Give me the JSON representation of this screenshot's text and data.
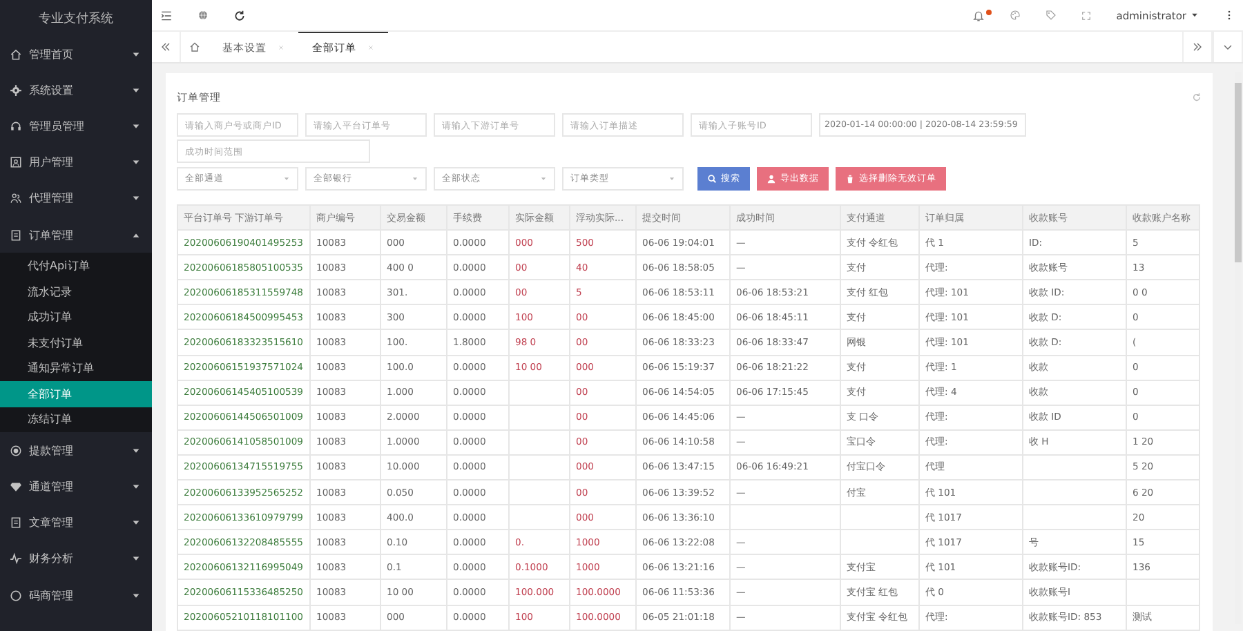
{
  "sidebar": {
    "title": "专业支付系统",
    "items": [
      {
        "label": "管理首页",
        "kind": "home",
        "expanded": false,
        "selected": false
      },
      {
        "label": "系统设置",
        "kind": "gear",
        "expanded": false,
        "selected": false
      },
      {
        "label": "管理员管理",
        "kind": "headset",
        "expanded": false,
        "selected": false
      },
      {
        "label": "用户管理",
        "kind": "user",
        "expanded": false,
        "selected": false
      },
      {
        "label": "代理管理",
        "kind": "people",
        "expanded": false,
        "selected": false
      },
      {
        "label": "订单管理",
        "kind": "doc",
        "expanded": true,
        "selected": false,
        "children": [
          {
            "label": "代付Api订单",
            "selected": false
          },
          {
            "label": "流水记录",
            "selected": false
          },
          {
            "label": "成功订单",
            "selected": false
          },
          {
            "label": "未支付订单",
            "selected": false
          },
          {
            "label": "通知异常订单",
            "selected": false
          },
          {
            "label": "全部订单",
            "selected": true
          },
          {
            "label": "冻结订单",
            "selected": false
          }
        ]
      },
      {
        "label": "提款管理",
        "kind": "target",
        "expanded": false,
        "selected": false
      },
      {
        "label": "通道管理",
        "kind": "diamond",
        "expanded": false,
        "selected": false
      },
      {
        "label": "文章管理",
        "kind": "doc",
        "expanded": false,
        "selected": false
      },
      {
        "label": "财务分析",
        "kind": "chart",
        "expanded": false,
        "selected": false
      },
      {
        "label": "码商管理",
        "kind": "circle",
        "expanded": false,
        "selected": false
      }
    ]
  },
  "topbar": {
    "user": "administrator",
    "notification": true
  },
  "tabs": [
    {
      "label": "基本设置",
      "selected": false
    },
    {
      "label": "全部订单",
      "selected": true
    }
  ],
  "panel": {
    "title": "订单管理",
    "fields": [
      {
        "kind": "input",
        "placeholder": "请输入商户号或商户ID"
      },
      {
        "kind": "input",
        "placeholder": "请输入平台订单号"
      },
      {
        "kind": "input",
        "placeholder": "请输入下游订单号"
      },
      {
        "kind": "input",
        "placeholder": "请输入订单描述"
      },
      {
        "kind": "input",
        "placeholder": "请输入子账号ID"
      },
      {
        "kind": "date",
        "value": "2020-01-14 00:00:00 | 2020-08-14 23:59:59"
      },
      {
        "kind": "input",
        "placeholder": "成功时间范围"
      }
    ],
    "selects": [
      "全部通道",
      "全部银行",
      "全部状态",
      "订单类型"
    ],
    "buttons": [
      {
        "label": "搜索",
        "kind": "search"
      },
      {
        "label": "导出数据",
        "kind": "export"
      },
      {
        "label": "选择删除无效订单",
        "kind": "delete"
      }
    ],
    "columns": [
      {
        "label": "平台订单号 下游订单号",
        "kind": "order"
      },
      {
        "label": "商户编号",
        "kind": "plain"
      },
      {
        "label": "交易金额",
        "kind": "plain"
      },
      {
        "label": "手续费",
        "kind": "plain"
      },
      {
        "label": "实际金额",
        "kind": "money"
      },
      {
        "label": "浮动实际...",
        "kind": "money"
      },
      {
        "label": "提交时间",
        "kind": "plain"
      },
      {
        "label": "成功时间",
        "kind": "plain"
      },
      {
        "label": "支付通道",
        "kind": "plain"
      },
      {
        "label": "订单归属",
        "kind": "plain"
      },
      {
        "label": "收款账号",
        "kind": "plain"
      },
      {
        "label": "收款账户名称",
        "kind": "plain"
      }
    ],
    "rows": [
      [
        "20200606190401495253",
        "10083",
        "000",
        "0.0000",
        "000",
        "500",
        "06-06 19:04:01",
        "—",
        "支付 令红包",
        "代 1",
        "ID:",
        "5"
      ],
      [
        "20200606185805100535",
        "10083",
        "400 0",
        "0.0000",
        "00",
        "40",
        "06-06 18:58:05",
        "—",
        "支付",
        "代理:",
        "收款账号",
        "13"
      ],
      [
        "20200606185311559748",
        "10083",
        "301.",
        "0.0000",
        "00",
        "5",
        "06-06 18:53:11",
        "06-06 18:53:21",
        "支付 红包",
        "代理: 101",
        "收款 ID:",
        "0 0"
      ],
      [
        "20200606184500995453",
        "10083",
        "300",
        "0.0000",
        "100",
        "00",
        "06-06 18:45:00",
        "06-06 18:45:11",
        "支付",
        "代理: 101",
        "收款 D:",
        "0"
      ],
      [
        "20200606183323515610",
        "10083",
        "100.",
        "1.8000",
        "98 0",
        "00",
        "06-06 18:33:23",
        "06-06 18:33:47",
        "网银",
        "代理: 101",
        "收款 D:",
        "("
      ],
      [
        "20200606151937571024",
        "10083",
        "100.0",
        "0.0000",
        "10 00",
        "000",
        "06-06 15:19:37",
        "06-06 18:21:22",
        "支付",
        "代理: 1",
        "收款",
        "0"
      ],
      [
        "20200606145405100539",
        "10083",
        "1.000",
        "0.0000",
        null,
        "00",
        "06-06 14:54:05",
        "06-06 17:15:45",
        "支付",
        "代理: 4",
        "收款",
        "0"
      ],
      [
        "20200606144506501009",
        "10083",
        "2.0000",
        "0.0000",
        null,
        "00",
        "06-06 14:45:06",
        "—",
        "支 口令",
        "代理:",
        "收款 ID",
        "0"
      ],
      [
        "20200606141058501009",
        "10083",
        "1.0000",
        "0.0000",
        null,
        "00",
        "06-06 14:10:58",
        "—",
        "宝口令",
        "代理:",
        "收 H",
        "1 20"
      ],
      [
        "20200606134715519755",
        "10083",
        "10.000",
        "0.0000",
        null,
        "000",
        "06-06 13:47:15",
        "06-06 16:49:21",
        "付宝口令",
        "代理",
        null,
        "5 20"
      ],
      [
        "20200606133952565252",
        "10083",
        "0.050",
        "0.0000",
        null,
        "00",
        "06-06 13:39:52",
        "—",
        "付宝",
        "代 101",
        null,
        "6 20"
      ],
      [
        "20200606133610979799",
        "10083",
        "400.0",
        "0.0000",
        null,
        "000",
        "06-06 13:36:10",
        null,
        null,
        "代 1017",
        null,
        "20"
      ],
      [
        "20200606132208485555",
        "10083",
        "0.10",
        "0.0000",
        "0.",
        "1000",
        "06-06 13:22:08",
        "—",
        null,
        "代 1017",
        "号",
        "15"
      ],
      [
        "20200606132116995049",
        "10083",
        "0.1",
        "0.0000",
        "0.1000",
        "1000",
        "06-06 13:21:16",
        "—",
        "支付宝",
        "代 101",
        "收款账号ID:",
        "136"
      ],
      [
        "20200606115336485250",
        "10083",
        "10 00",
        "0.0000",
        "100.000",
        "100.0000",
        "06-06 11:53:36",
        "—",
        "支付宝 红包",
        "代 0",
        "收款账号I",
        null
      ],
      [
        "20200605210118101100",
        "10083",
        "000",
        "0.0000",
        "100",
        "100.0000",
        "06-05 21:01:18",
        "—",
        "支付宝 令红包",
        "代理:",
        "收款账号ID: 853",
        "测试"
      ]
    ]
  }
}
